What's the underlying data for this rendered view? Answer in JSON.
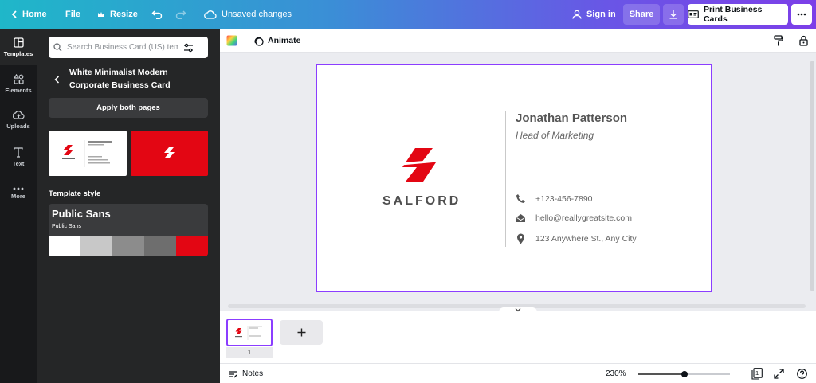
{
  "topbar": {
    "home": "Home",
    "file": "File",
    "resize": "Resize",
    "status": "Unsaved changes",
    "sign_in": "Sign in",
    "share": "Share",
    "print": "Print Business Cards"
  },
  "rail": {
    "items": [
      {
        "label": "Templates",
        "icon": "templates-icon"
      },
      {
        "label": "Elements",
        "icon": "elements-icon"
      },
      {
        "label": "Uploads",
        "icon": "upload-icon"
      },
      {
        "label": "Text",
        "icon": "text-icon"
      },
      {
        "label": "More",
        "icon": "more-icon"
      }
    ]
  },
  "panel": {
    "search_placeholder": "Search Business Card (US) templates",
    "template_title": "White Minimalist Modern Corporate Business Card",
    "apply_button": "Apply both pages",
    "style_heading": "Template style",
    "font_name": "Public Sans",
    "font_sub": "Public Sans",
    "swatches": [
      "#ffffff",
      "#c8c8c8",
      "#8c8c8c",
      "#6e6e6e",
      "#e30613"
    ]
  },
  "toolbar": {
    "animate": "Animate"
  },
  "card": {
    "brand": "SALFORD",
    "name": "Jonathan Patterson",
    "role": "Head of Marketing",
    "phone": "+123-456-7890",
    "email": "hello@reallygreatsite.com",
    "address": "123 Anywhere St., Any City",
    "accent": "#e30613"
  },
  "pages": {
    "current": "1"
  },
  "bottom": {
    "notes": "Notes",
    "zoom": "230%",
    "zoom_slider_fraction": 0.5,
    "page_count": "1"
  }
}
